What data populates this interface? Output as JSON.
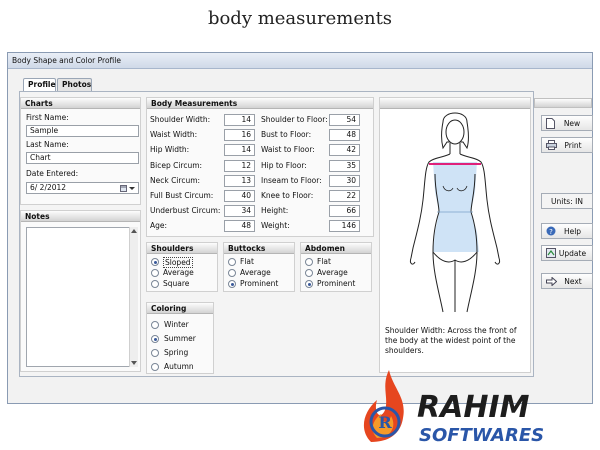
{
  "caption": "body measurements",
  "window": {
    "title": "Body Shape and Color Profile"
  },
  "tabs": [
    "Profile",
    "Photos"
  ],
  "charts": {
    "header": "Charts",
    "first_name_label": "First Name:",
    "first_name": "Sample",
    "last_name_label": "Last Name:",
    "last_name": "Chart",
    "date_label": "Date Entered:",
    "date": "6/  2/2012"
  },
  "notes": {
    "header": "Notes"
  },
  "measurements": {
    "header": "Body Measurements",
    "left": [
      {
        "label": "Shoulder Width:",
        "value": "14"
      },
      {
        "label": "Waist Width:",
        "value": "16"
      },
      {
        "label": "Hip Width:",
        "value": "14"
      },
      {
        "label": "Bicep Circum:",
        "value": "12"
      },
      {
        "label": "Neck Circum:",
        "value": "13"
      },
      {
        "label": "Full Bust Circum:",
        "value": "40"
      },
      {
        "label": "Underbust Circum:",
        "value": "34"
      },
      {
        "label": "Age:",
        "value": "48"
      }
    ],
    "right": [
      {
        "label": "Shoulder to Floor:",
        "value": "54"
      },
      {
        "label": "Bust to Floor:",
        "value": "48"
      },
      {
        "label": "Waist to Floor:",
        "value": "42"
      },
      {
        "label": "Hip to Floor:",
        "value": "35"
      },
      {
        "label": "Inseam to Floor:",
        "value": "30"
      },
      {
        "label": "Knee to Floor:",
        "value": "22"
      },
      {
        "label": "Height:",
        "value": "66"
      },
      {
        "label": "Weight:",
        "value": "146"
      }
    ]
  },
  "shoulders": {
    "header": "Shoulders",
    "options": [
      "Sloped",
      "Average",
      "Square"
    ],
    "selected": 0
  },
  "buttocks": {
    "header": "Buttocks",
    "options": [
      "Flat",
      "Average",
      "Prominent"
    ],
    "selected": 2
  },
  "abdomen": {
    "header": "Abdomen",
    "options": [
      "Flat",
      "Average",
      "Prominent"
    ],
    "selected": 2
  },
  "coloring": {
    "header": "Coloring",
    "options": [
      "Winter",
      "Summer",
      "Spring",
      "Autumn"
    ],
    "selected": 1
  },
  "figure": {
    "description": "Shoulder Width: Across the front of the body at the widest point of the shoulders."
  },
  "buttons": {
    "new": "New",
    "print": "Print",
    "units": "Units: IN",
    "help": "Help",
    "update": "Update",
    "next": "Next"
  },
  "icons": [
    "new-document-icon",
    "printer-icon",
    "help-icon",
    "update-icon",
    "next-arrow-icon",
    "calendar-icon",
    "dropdown-arrow-icon"
  ],
  "colors": {
    "accent": "#e0207a",
    "body_fill": "#cfe3f6",
    "title_bar": "#cfd9e8"
  }
}
